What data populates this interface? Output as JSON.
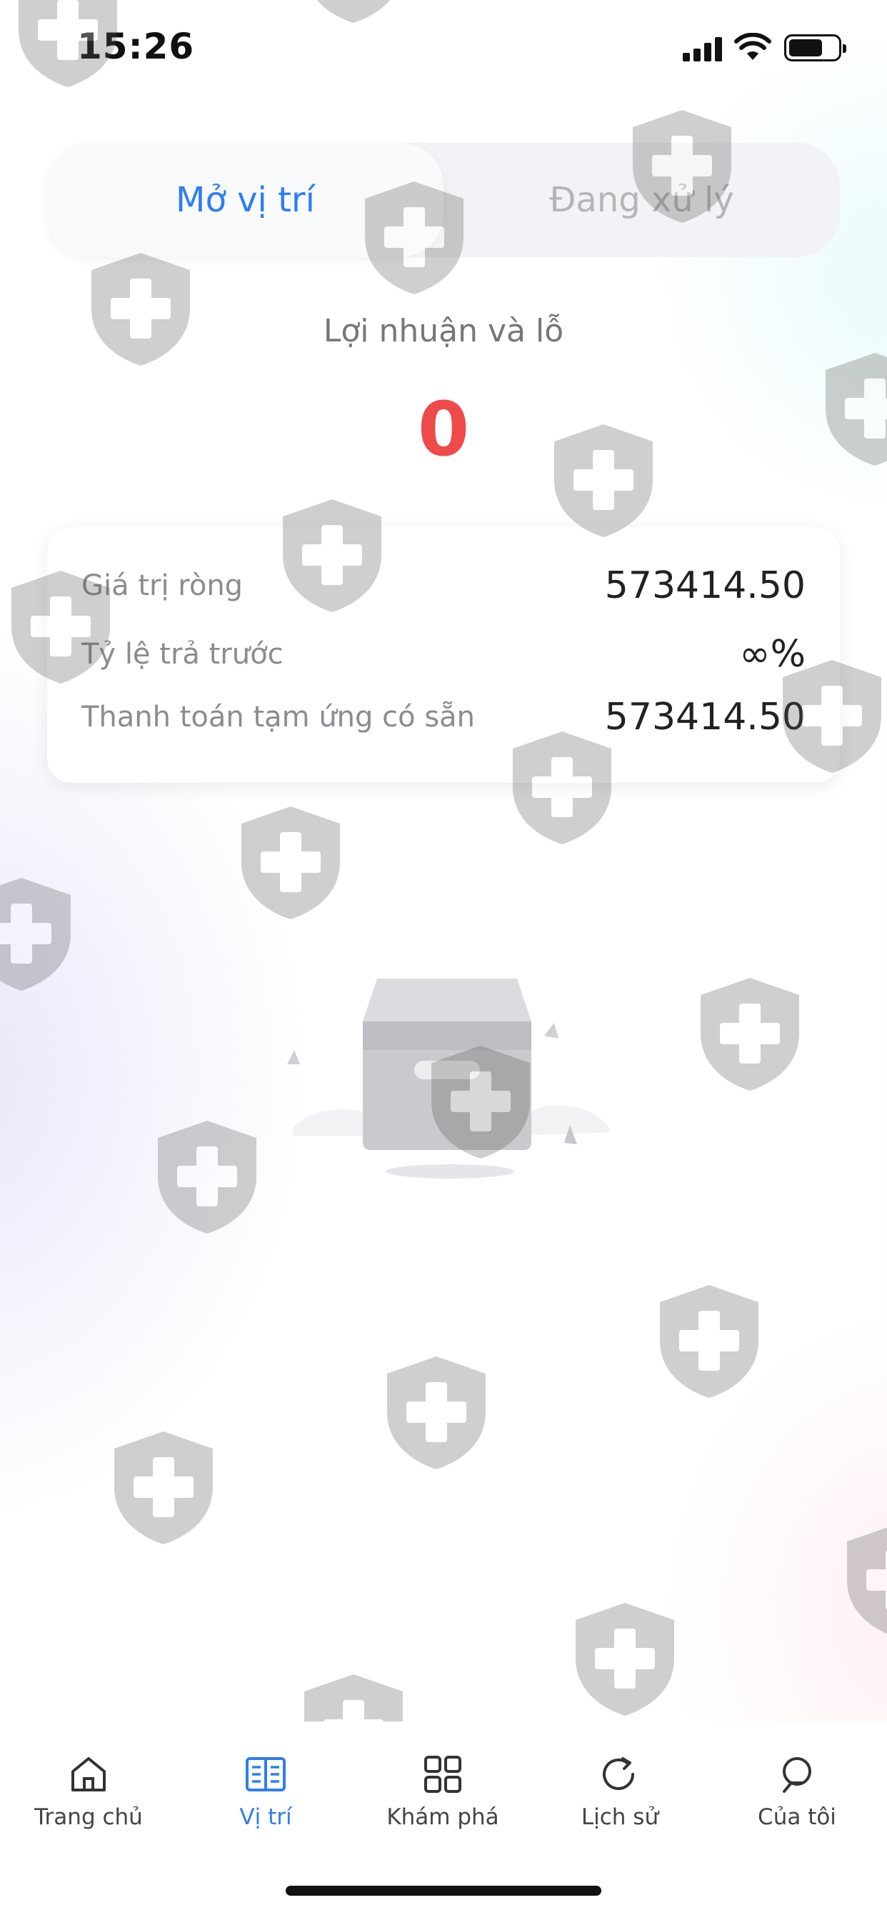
{
  "status_bar": {
    "time": "15:26"
  },
  "tabs": [
    {
      "label": "Mở vị trí",
      "active": true
    },
    {
      "label": "Đang xử lý",
      "active": false
    }
  ],
  "pnl": {
    "label": "Lợi nhuận và lỗ",
    "value": "0"
  },
  "summary": {
    "rows": [
      {
        "label": "Giá trị ròng",
        "value": "573414.50"
      },
      {
        "label": "Tỷ lệ trả trước",
        "value": "∞%"
      },
      {
        "label": "Thanh toán tạm ứng có sẵn",
        "value": "573414.50"
      }
    ]
  },
  "bottom_nav": {
    "items": [
      {
        "label": "Trang chủ",
        "icon": "home-icon"
      },
      {
        "label": "Vị trí",
        "icon": "book-icon",
        "active": true
      },
      {
        "label": "Khám phá",
        "icon": "grid-icon"
      },
      {
        "label": "Lịch sử",
        "icon": "refresh-icon"
      },
      {
        "label": "Của tôi",
        "icon": "user-icon"
      }
    ]
  },
  "colors": {
    "accent": "#2f7df0",
    "loss": "#ee4a4a",
    "muted": "#8c8c90"
  }
}
